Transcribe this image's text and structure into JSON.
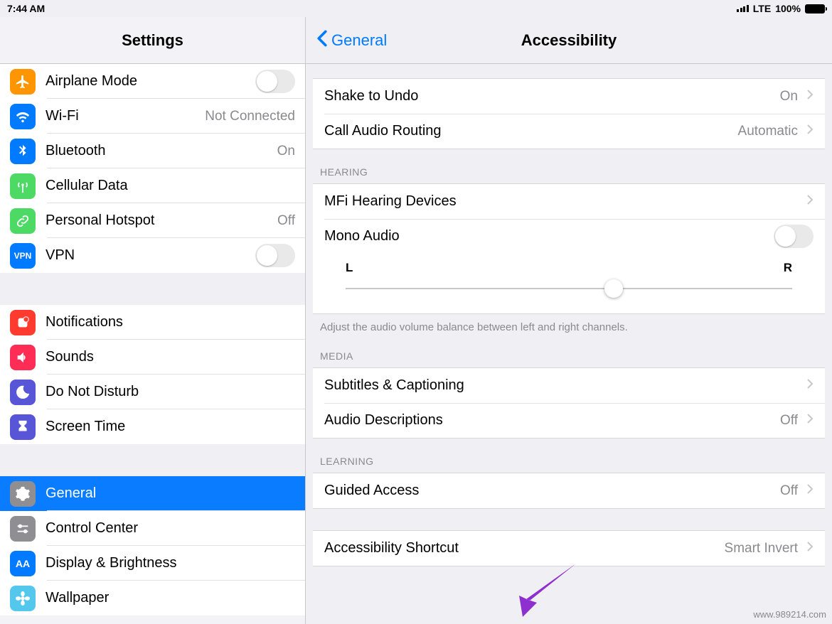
{
  "statusbar": {
    "time": "7:44 AM",
    "carrier": "LTE",
    "battery": "100%"
  },
  "sidebar": {
    "title": "Settings",
    "group1": [
      {
        "id": "airplane",
        "label": "Airplane Mode",
        "ctrl": "switch",
        "icon_bg": "#ff9500"
      },
      {
        "id": "wifi",
        "label": "Wi-Fi",
        "value": "Not Connected",
        "icon_bg": "#007aff"
      },
      {
        "id": "bluetooth",
        "label": "Bluetooth",
        "value": "On",
        "icon_bg": "#007aff"
      },
      {
        "id": "cellular",
        "label": "Cellular Data",
        "icon_bg": "#4cd964"
      },
      {
        "id": "hotspot",
        "label": "Personal Hotspot",
        "value": "Off",
        "icon_bg": "#4cd964"
      },
      {
        "id": "vpn",
        "label": "VPN",
        "ctrl": "switch",
        "icon_bg": "#007aff",
        "icon_text": "VPN"
      }
    ],
    "group2": [
      {
        "id": "notifications",
        "label": "Notifications",
        "icon_bg": "#ff3b30"
      },
      {
        "id": "sounds",
        "label": "Sounds",
        "icon_bg": "#ff2d55"
      },
      {
        "id": "dnd",
        "label": "Do Not Disturb",
        "icon_bg": "#5856d6"
      },
      {
        "id": "screentime",
        "label": "Screen Time",
        "icon_bg": "#5856d6"
      }
    ],
    "group3": [
      {
        "id": "general",
        "label": "General",
        "icon_bg": "#8e8e93",
        "selected": true
      },
      {
        "id": "controlcenter",
        "label": "Control Center",
        "icon_bg": "#8e8e93"
      },
      {
        "id": "display",
        "label": "Display & Brightness",
        "icon_bg": "#007aff",
        "icon_text": "AA"
      },
      {
        "id": "wallpaper",
        "label": "Wallpaper",
        "icon_bg": "#54c7ec"
      }
    ]
  },
  "detail": {
    "back": "General",
    "title": "Accessibility",
    "interaction": [
      {
        "id": "shake",
        "label": "Shake to Undo",
        "value": "On"
      },
      {
        "id": "callrouting",
        "label": "Call Audio Routing",
        "value": "Automatic"
      }
    ],
    "hearing_header": "HEARING",
    "hearing": [
      {
        "id": "mfi",
        "label": "MFi Hearing Devices"
      },
      {
        "id": "mono",
        "label": "Mono Audio",
        "ctrl": "switch"
      }
    ],
    "balance": {
      "left": "L",
      "right": "R",
      "pos": 0.6
    },
    "balance_footer": "Adjust the audio volume balance between left and right channels.",
    "media_header": "MEDIA",
    "media": [
      {
        "id": "subtitles",
        "label": "Subtitles & Captioning"
      },
      {
        "id": "audiodesc",
        "label": "Audio Descriptions",
        "value": "Off"
      }
    ],
    "learning_header": "LEARNING",
    "learning": [
      {
        "id": "guided",
        "label": "Guided Access",
        "value": "Off"
      }
    ],
    "shortcut": [
      {
        "id": "shortcut",
        "label": "Accessibility Shortcut",
        "value": "Smart Invert"
      }
    ]
  },
  "watermark": "www.989214.com"
}
